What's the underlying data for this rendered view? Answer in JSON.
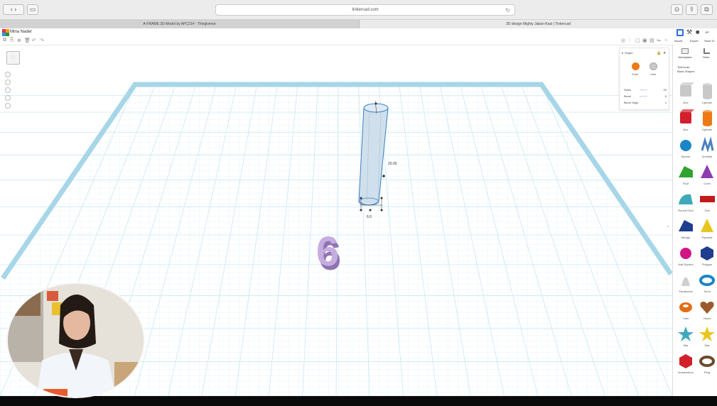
{
  "browser": {
    "url": "tinkercad.com",
    "tabs": [
      {
        "label": "A-FRAME 3D-Model by APC214 - Thingiverse"
      },
      {
        "label": "3D design Mighty Jaban-Kasi | Tinkercad"
      }
    ]
  },
  "app": {
    "design_name": "Mina Nader",
    "colors": {
      "accent": "#2f6edb",
      "grid_line": "#bfe3ef",
      "grid_border": "#9dd2e6",
      "cylinder": "#cbdcea",
      "shape6": "#b9a1d6"
    }
  },
  "right_tabs": [
    {
      "label": "Import",
      "icon": "grid-icon"
    },
    {
      "label": "Export",
      "icon": "hammer-icon"
    },
    {
      "label": "Send To",
      "icon": "briefcase-icon"
    }
  ],
  "shape_panel": {
    "title": "Shape",
    "solid_label": "Solid",
    "hole_label": "Hole",
    "props": [
      {
        "name": "Sides",
        "value": "20"
      },
      {
        "name": "Bevel",
        "value": "0"
      },
      {
        "name": "Bevel Segs",
        "value": "1"
      }
    ]
  },
  "sidebar": {
    "categories": [
      {
        "label": "Workplane"
      },
      {
        "label": "Ruler"
      }
    ],
    "section_lines": [
      "Tinkercad",
      "Basic Shapes"
    ],
    "shapes": [
      {
        "label": "Box",
        "color": "#c8c8c8",
        "kind": "box"
      },
      {
        "label": "Cylinder",
        "color": "#c8c8c8",
        "kind": "cylinder"
      },
      {
        "label": "Box",
        "color": "#d11f2b",
        "kind": "box"
      },
      {
        "label": "Cylinder",
        "color": "#ee7a16",
        "kind": "cylinder"
      },
      {
        "label": "Sphere",
        "color": "#1a86c7",
        "kind": "sphere"
      },
      {
        "label": "Scribble",
        "color": "#4c7fc0",
        "kind": "scribble"
      },
      {
        "label": "Roof",
        "color": "#2fa32f",
        "kind": "roof"
      },
      {
        "label": "Cone",
        "color": "#8e3cb2",
        "kind": "cone"
      },
      {
        "label": "Round Roof",
        "color": "#3fa9b9",
        "kind": "roundroof"
      },
      {
        "label": "Text",
        "color": "#c21a1a",
        "kind": "text"
      },
      {
        "label": "Wedge",
        "color": "#1e3d8f",
        "kind": "wedge"
      },
      {
        "label": "Pyramid",
        "color": "#e9c61e",
        "kind": "pyramid"
      },
      {
        "label": "Half Sphere",
        "color": "#d11584",
        "kind": "halfsphere"
      },
      {
        "label": "Polygon",
        "color": "#1e3d8f",
        "kind": "polygon"
      },
      {
        "label": "Paraboloid",
        "color": "#cfcfcf",
        "kind": "paraboloid"
      },
      {
        "label": "Torus",
        "color": "#1a86c7",
        "kind": "torus"
      },
      {
        "label": "Tube",
        "color": "#e46d12",
        "kind": "tube"
      },
      {
        "label": "Heart",
        "color": "#9b5a2a",
        "kind": "heart"
      },
      {
        "label": "Star",
        "color": "#3fa9b9",
        "kind": "star"
      },
      {
        "label": "Star",
        "color": "#e9c61e",
        "kind": "star"
      },
      {
        "label": "Icosahedron",
        "color": "#d11f2b",
        "kind": "polygon"
      },
      {
        "label": "Ring",
        "color": "#6a4a2a",
        "kind": "torus"
      }
    ]
  },
  "viewport": {
    "dim_height": "20.00",
    "dim_width": "6.0",
    "number_shape": "6"
  }
}
